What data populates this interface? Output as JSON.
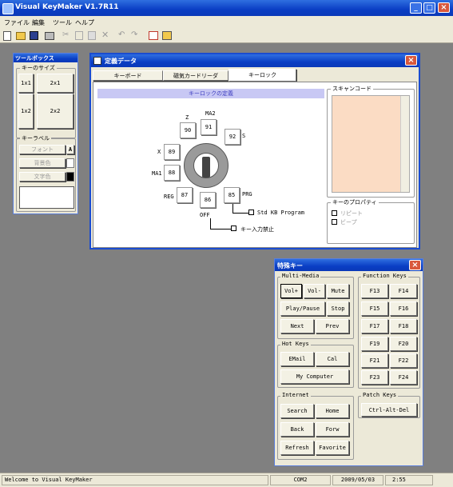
{
  "app": {
    "title": "Visual KeyMaker V1.7R11"
  },
  "menu": [
    "ファイル",
    "編集",
    "ツール",
    "ヘルプ"
  ],
  "toolbar_icons": [
    "new-file-icon",
    "open-folder-icon",
    "save-icon",
    "print-icon",
    "cut-icon",
    "copy-icon",
    "paste-icon",
    "delete-icon",
    "undo-icon",
    "redo-icon",
    "window-icon",
    "settings-icon"
  ],
  "toolbox": {
    "title": "ツールボックス",
    "key_size_label": "キーのサイズ",
    "sizes": [
      "1x1",
      "2x1",
      "1x2",
      "2x2"
    ],
    "key_label_group": "キーラベル",
    "font_btn": "フォント",
    "font_suffix": "A",
    "bg_color_btn": "背景色",
    "text_color_btn": "文字色"
  },
  "definition": {
    "title": "定義データ",
    "tabs": [
      "キーボード",
      "磁気カードリーダ",
      "キーロック"
    ],
    "section_title": "キーロックの定義",
    "positions": {
      "z": "Z",
      "ma2": "MA2",
      "s": "S",
      "x": "X",
      "ma1": "MA1",
      "reg": "REG",
      "off": "OFF",
      "prg": "PRG"
    },
    "codes": {
      "k90": "90",
      "k91": "91",
      "k92": "92",
      "k89": "89",
      "k88": "88",
      "k87": "87",
      "k86": "86",
      "k85": "85"
    },
    "std_kb_program": "Std KB Program",
    "key_input_disabled": "キー入力禁止",
    "scan_code_label": "スキャンコード",
    "key_properties_label": "キーのプロパティ",
    "repeat_label": "リピート",
    "beep_label": "ビープ"
  },
  "special_keys": {
    "title": "特殊キー",
    "multimedia": {
      "label": "Multi-Media",
      "buttons": [
        "Vol+",
        "Vol-",
        "Mute",
        "Play/Pause",
        "Stop",
        "Next",
        "Prev"
      ]
    },
    "hotkeys": {
      "label": "Hot Keys",
      "buttons": [
        "EMail",
        "Cal",
        "My Computer"
      ]
    },
    "internet": {
      "label": "Internet",
      "buttons": [
        "Search",
        "Home",
        "Back",
        "Forw",
        "Refresh",
        "Favorite"
      ]
    },
    "function": {
      "label": "Function Keys",
      "buttons": [
        "F13",
        "F14",
        "F15",
        "F16",
        "F17",
        "F18",
        "F19",
        "F20",
        "F21",
        "F22",
        "F23",
        "F24"
      ]
    },
    "patch": {
      "label": "Patch Keys",
      "buttons": [
        "Ctrl-Alt-Del"
      ]
    }
  },
  "status": {
    "message": "Welcome to Visual KeyMaker",
    "port": "COM2",
    "date": "2009/05/03",
    "time": "2:55"
  }
}
